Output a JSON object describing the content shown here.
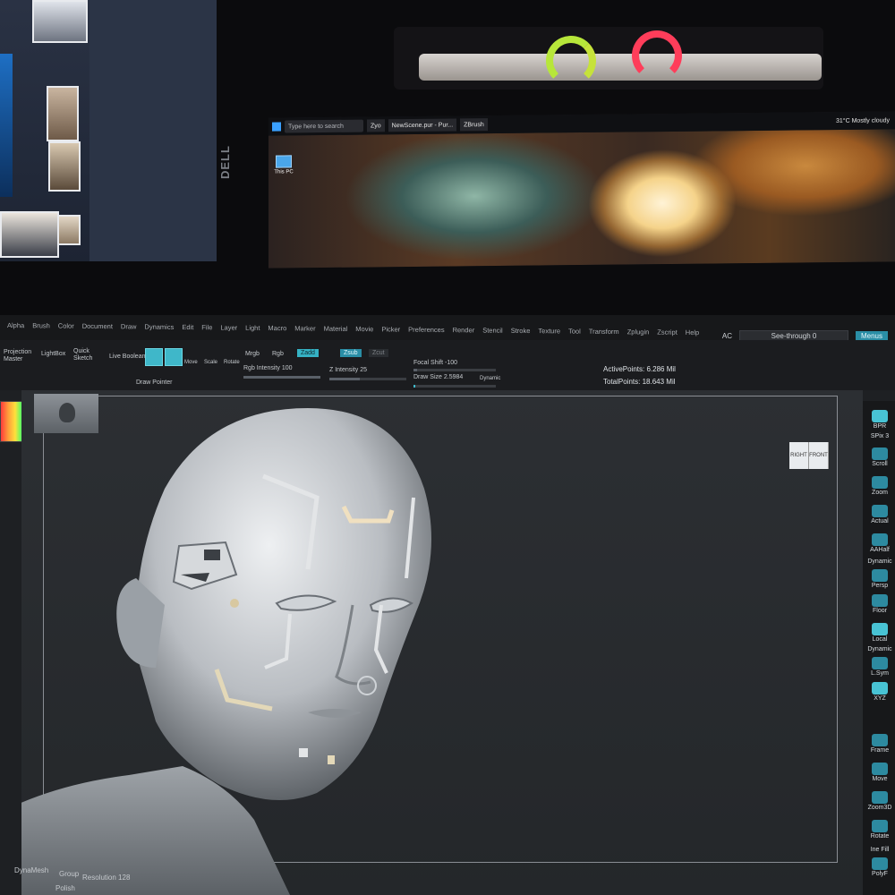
{
  "background_monitor": {
    "brand": "DELL",
    "taskbar": {
      "search_placeholder": "Type here to search",
      "apps": [
        "Zyo",
        "NewScene.pur - Pur...",
        "ZBrush"
      ],
      "weather": "31°C Mostly cloudy"
    },
    "desktop_icon_label": "This PC"
  },
  "zbrush": {
    "menu": [
      "Alpha",
      "Brush",
      "Color",
      "Document",
      "Draw",
      "Dynamics",
      "Edit",
      "File",
      "Layer",
      "Light",
      "Macro",
      "Marker",
      "Material",
      "Movie",
      "Picker",
      "Preferences",
      "Render",
      "Stencil",
      "Stroke",
      "Texture",
      "Tool",
      "Transform",
      "Zplugin",
      "Zscript",
      "Help"
    ],
    "menu_right": {
      "ac": "AC",
      "see_through_label": "See-through",
      "see_through_value": "0",
      "menus_button": "Menus"
    },
    "toolbar": {
      "projection_master": "Projection Master",
      "lightbox": "LightBox",
      "quick_sketch": "Quick Sketch",
      "live_boolean": "Live Boolean",
      "edit": "Edit",
      "draw": "Draw",
      "move": "Move",
      "scale": "Scale",
      "rotate": "Rotate",
      "mrgb": "Mrgb",
      "rgb": "Rgb",
      "m": "M",
      "zadd": "Zadd",
      "zsub": "Zsub",
      "zcut": "Zcut",
      "rgb_intensity_label": "Rgb Intensity",
      "rgb_intensity_value": "100",
      "z_intensity_label": "Z Intensity",
      "z_intensity_value": "25",
      "focal_shift_label": "Focal Shift",
      "focal_shift_value": "-100",
      "draw_size_label": "Draw Size",
      "draw_size_value": "2.5984",
      "dynamic": "Dynamic",
      "active_points_label": "ActivePoints:",
      "active_points_value": "6.286 Mil",
      "total_points_label": "TotalPoints:",
      "total_points_value": "18.643 Mil",
      "draw_pointer": "Draw Pointer"
    },
    "nav_cube": [
      "RIGHT",
      "FRONT"
    ],
    "right_shelf": [
      "BPR",
      "SPix 3",
      "Scroll",
      "Zoom",
      "Actual",
      "AAHalf",
      "Dynamic",
      "Persp",
      "Floor",
      "Local",
      "Dynamic",
      "L.Sym",
      "XYZ",
      "Frame",
      "Move",
      "Zoom3D",
      "Rotate",
      "Ine Fill",
      "PolyF"
    ],
    "bottom": {
      "dynamesh": "DynaMesh",
      "group": "Group",
      "polish": "Polish",
      "resolution_label": "Resolution",
      "resolution_value": "128"
    }
  }
}
